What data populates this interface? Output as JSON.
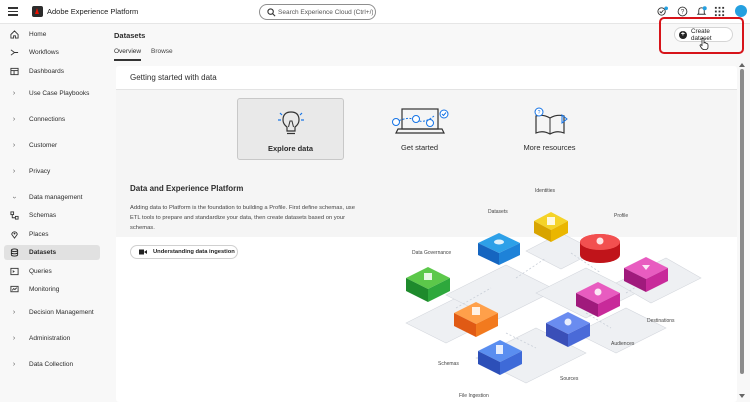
{
  "topbar": {
    "app_title": "Adobe Experience Platform",
    "search_placeholder": "Search Experience Cloud (Ctrl+/)"
  },
  "sidebar": {
    "items": [
      {
        "label": "Home",
        "icon": "home-icon"
      },
      {
        "label": "Workflows",
        "icon": "workflows-icon"
      },
      {
        "label": "Dashboards",
        "icon": "dashboards-icon"
      },
      {
        "label": "Use Case Playbooks",
        "icon": "chevron-right-icon"
      },
      {
        "label": "Connections",
        "icon": "chevron-right-icon"
      },
      {
        "label": "Customer",
        "icon": "chevron-right-icon"
      },
      {
        "label": "Privacy",
        "icon": "chevron-right-icon"
      },
      {
        "label": "Data management",
        "icon": "chevron-down-icon"
      },
      {
        "label": "Schemas",
        "icon": "schemas-icon"
      },
      {
        "label": "Places",
        "icon": "places-icon"
      },
      {
        "label": "Datasets",
        "icon": "datasets-icon"
      },
      {
        "label": "Queries",
        "icon": "queries-icon"
      },
      {
        "label": "Monitoring",
        "icon": "monitoring-icon"
      },
      {
        "label": "Decision Management",
        "icon": "chevron-right-icon"
      },
      {
        "label": "Administration",
        "icon": "chevron-right-icon"
      },
      {
        "label": "Data Collection",
        "icon": "chevron-right-icon"
      }
    ]
  },
  "header": {
    "title": "Datasets",
    "tabs": [
      "Overview",
      "Browse"
    ],
    "create_label": "Create dataset"
  },
  "card": {
    "title": "Getting started with data",
    "tiles": [
      "Explore data",
      "Get started",
      "More resources"
    ],
    "section_title": "Data and Experience Platform",
    "section_body": "Adding data to Platform is the foundation to building a Profile. First define schemas, use ETL tools to prepare and standardize your data, then create datasets based on your schemas.",
    "ingestion_button": "Understanding data ingestion"
  },
  "illustration": {
    "labels": [
      "Identities",
      "Datasets",
      "Profile",
      "Data Governance",
      "Destinations",
      "Audiences",
      "Schemas",
      "Sources",
      "File Ingestion"
    ]
  },
  "colors": {
    "accent_red": "#eb1000",
    "highlight_red": "#d7141a",
    "avatar_blue": "#24a0e0"
  }
}
